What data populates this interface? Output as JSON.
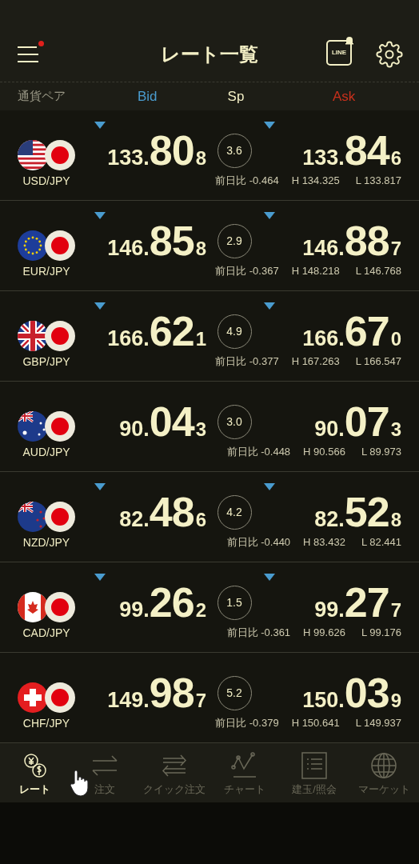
{
  "header": {
    "title": "レート一覧",
    "menu_notification": true,
    "line_badge": "LINE"
  },
  "columns": {
    "pair": "通貨ペア",
    "bid": "Bid",
    "sp": "Sp",
    "ask": "Ask"
  },
  "rows": [
    {
      "pair": "USD/JPY",
      "kind": "us",
      "bid": {
        "prefix": "133.",
        "big": "80",
        "pip": "8",
        "falling": true
      },
      "spread": "3.6",
      "ask": {
        "prefix": "133.",
        "big": "84",
        "pip": "6",
        "falling": true
      },
      "change": "前日比 -0.464",
      "high": "H 134.325",
      "low": "L 133.817"
    },
    {
      "pair": "EUR/JPY",
      "kind": "eu",
      "bid": {
        "prefix": "146.",
        "big": "85",
        "pip": "8",
        "falling": true
      },
      "spread": "2.9",
      "ask": {
        "prefix": "146.",
        "big": "88",
        "pip": "7",
        "falling": true
      },
      "change": "前日比 -0.367",
      "high": "H 148.218",
      "low": "L 146.768"
    },
    {
      "pair": "GBP/JPY",
      "kind": "gb",
      "bid": {
        "prefix": "166.",
        "big": "62",
        "pip": "1",
        "falling": true
      },
      "spread": "4.9",
      "ask": {
        "prefix": "166.",
        "big": "67",
        "pip": "0",
        "falling": true
      },
      "change": "前日比 -0.377",
      "high": "H 167.263",
      "low": "L 166.547"
    },
    {
      "pair": "AUD/JPY",
      "kind": "au",
      "bid": {
        "prefix": "90.",
        "big": "04",
        "pip": "3",
        "falling": false
      },
      "spread": "3.0",
      "ask": {
        "prefix": "90.",
        "big": "07",
        "pip": "3",
        "falling": false
      },
      "change": "前日比 -0.448",
      "high": "H 90.566",
      "low": "L 89.973"
    },
    {
      "pair": "NZD/JPY",
      "kind": "nz",
      "bid": {
        "prefix": "82.",
        "big": "48",
        "pip": "6",
        "falling": true
      },
      "spread": "4.2",
      "ask": {
        "prefix": "82.",
        "big": "52",
        "pip": "8",
        "falling": true
      },
      "change": "前日比 -0.440",
      "high": "H 83.432",
      "low": "L 82.441"
    },
    {
      "pair": "CAD/JPY",
      "kind": "ca",
      "bid": {
        "prefix": "99.",
        "big": "26",
        "pip": "2",
        "falling": true
      },
      "spread": "1.5",
      "ask": {
        "prefix": "99.",
        "big": "27",
        "pip": "7",
        "falling": true
      },
      "change": "前日比 -0.361",
      "high": "H 99.626",
      "low": "L 99.176"
    },
    {
      "pair": "CHF/JPY",
      "kind": "ch",
      "bid": {
        "prefix": "149.",
        "big": "98",
        "pip": "7",
        "falling": false
      },
      "spread": "5.2",
      "ask": {
        "prefix": "150.",
        "big": "03",
        "pip": "9",
        "falling": false
      },
      "change": "前日比 -0.379",
      "high": "H 150.641",
      "low": "L 149.937"
    }
  ],
  "nav": [
    {
      "kind": "rate",
      "label": "レート",
      "selected": true
    },
    {
      "kind": "order",
      "label": "注文",
      "selected": false
    },
    {
      "kind": "quick",
      "label": "クイック注文",
      "selected": false
    },
    {
      "kind": "chart",
      "label": "チャート",
      "selected": false
    },
    {
      "kind": "positions",
      "label": "建玉/照会",
      "selected": false
    },
    {
      "kind": "market",
      "label": "マーケット",
      "selected": false
    }
  ]
}
